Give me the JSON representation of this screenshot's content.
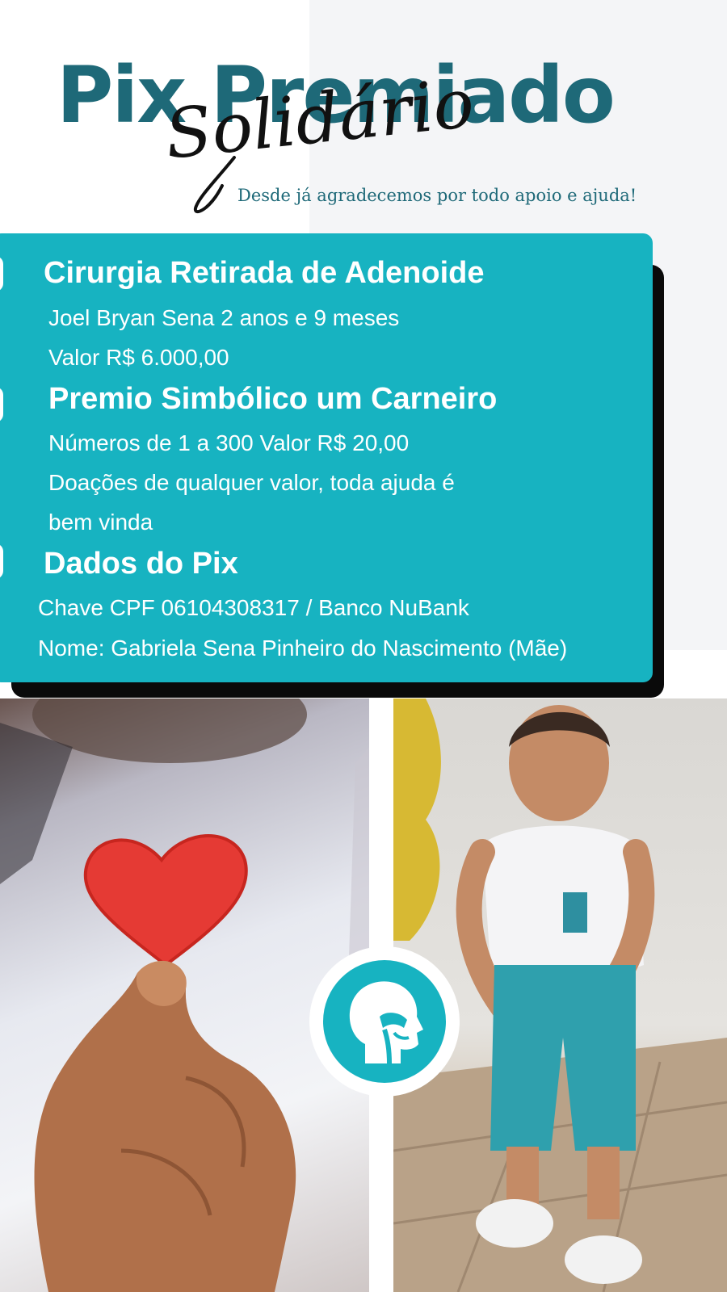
{
  "header": {
    "title": "Pix Premiado",
    "script_word": "Solidário",
    "tagline": "Desde já agradecemos por todo apoio e ajuda!"
  },
  "card": {
    "section1": {
      "heading": "Cirurgia Retirada de Adenoide",
      "line1": "Joel Bryan Sena 2 anos e  9 meses",
      "line2": "Valor R$ 6.000,00"
    },
    "section2": {
      "heading": "Premio Simbólico um Carneiro",
      "line1": "Números de 1 a 300 Valor R$ 20,00",
      "line2": "Doações de qualquer valor, toda ajuda é",
      "line3": "bem vinda"
    },
    "section3": {
      "heading": "Dados do Pix",
      "line1": "Chave CPF 06104308317  / Banco NuBank",
      "line2": "Nome: Gabriela Sena Pinheiro do Nascimento (Mãe)"
    }
  },
  "colors": {
    "teal": "#17b3c1",
    "dark_teal": "#1e6978",
    "heart_red": "#e53a34"
  },
  "icons": {
    "center": "head-throat-anatomy-icon"
  }
}
